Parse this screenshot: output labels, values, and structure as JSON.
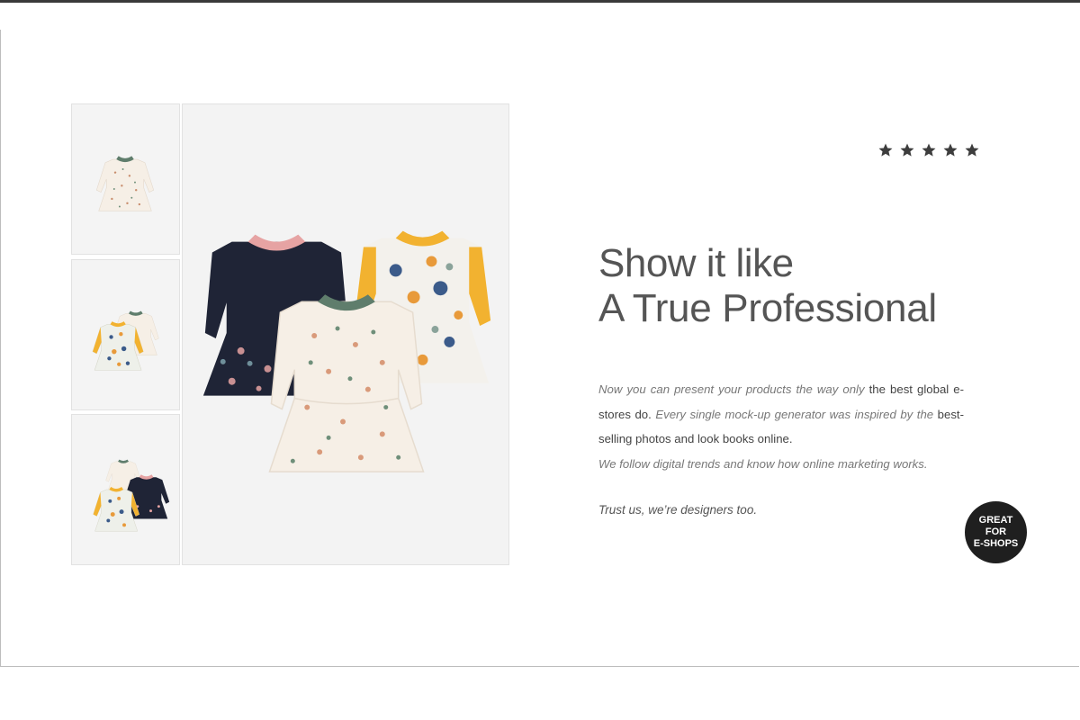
{
  "rating": {
    "stars": 5,
    "star_color": "#3d3d3d",
    "star_icon": "star-icon"
  },
  "headline": {
    "line1": "Show it like",
    "line2": "A True Professional"
  },
  "body": {
    "p1_intro": "Now you can present your products the way only ",
    "p1_bold": "the best global e-stores do.",
    "p1_mid": "  Every single mock-up generator was inspired by the ",
    "p1_bold2": "best-selling photos and look books online.",
    "p2": "We follow digital trends and know how online marketing works."
  },
  "tagline": "Trust us, we’re designers too.",
  "badge": {
    "line1": "GREAT",
    "line2": "FOR",
    "line3": "E-SHOPS"
  },
  "colors": {
    "navy": "#1f2436",
    "pink": "#e6a3a3",
    "cream": "#f6efe6",
    "sage": "#5f7d6c",
    "mustard": "#f2b230",
    "badge_bg": "#1f1f1f"
  }
}
